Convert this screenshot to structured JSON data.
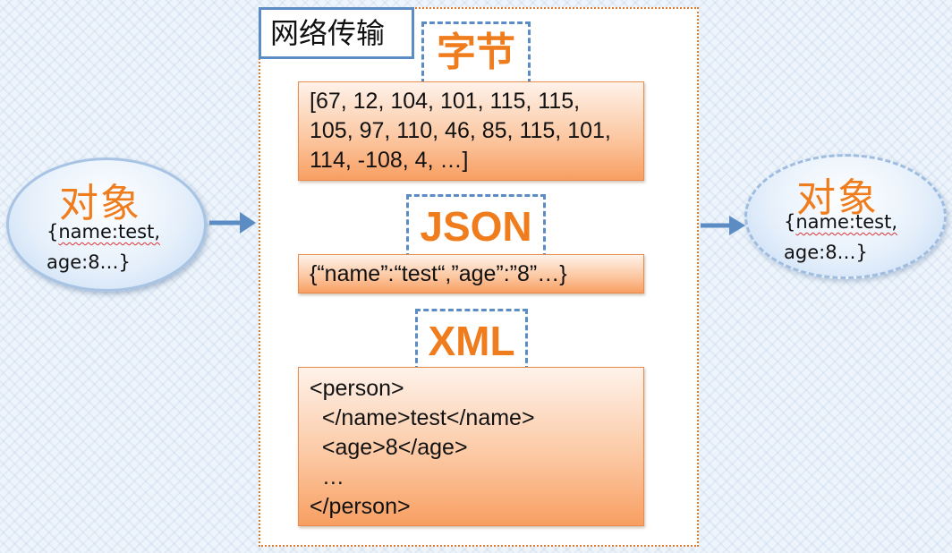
{
  "left_object": {
    "title": "对象",
    "line1": "{name:test,",
    "line2": "age:8…}"
  },
  "right_object": {
    "title": "对象",
    "line1": "{name:test,",
    "line2": "age:8…}"
  },
  "transport": {
    "title": "网络传输"
  },
  "formats": {
    "bytes": {
      "label": "字节",
      "lines": [
        "[67, 12, 104, 101, 115, 115,",
        "105, 97, 110, 46, 85, 115, 101,",
        "114, -108, 4, …]"
      ]
    },
    "json": {
      "label": "JSON",
      "content": "{“name”:“test“,”age”:”8”…}"
    },
    "xml": {
      "label": "XML",
      "lines": [
        "<person>",
        "  </name>test</name>",
        "  <age>8</age>",
        "  …",
        "</person>"
      ]
    }
  },
  "colors": {
    "accent_orange": "#f07d1d",
    "frame_blue": "#5b8cc4",
    "arrow_blue": "#5b8cc4"
  }
}
